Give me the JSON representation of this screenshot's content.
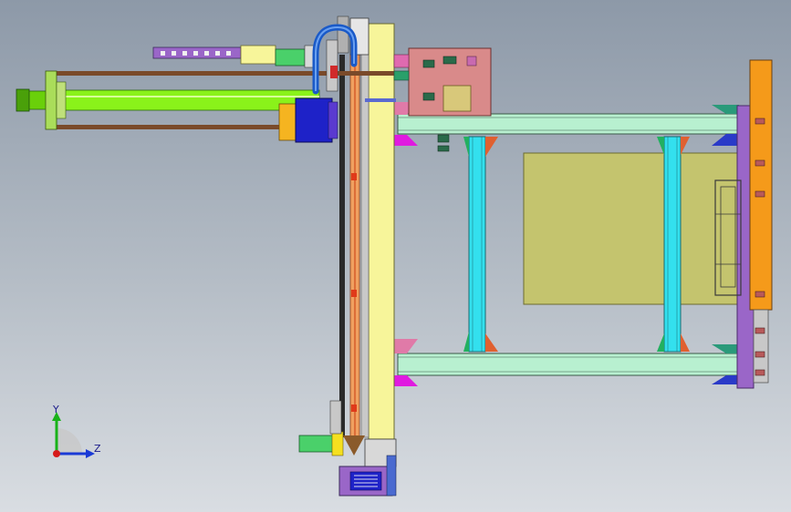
{
  "viewport": {
    "background_top": "#8d99a8",
    "background_bottom": "#d9dde2"
  },
  "triad": {
    "y_label": "Y",
    "z_label": "Z",
    "y_color": "#19b219",
    "z_color": "#1a3ad6",
    "x_color": "#d61a1a"
  },
  "colors": {
    "frame_rail": "#b8f0d0",
    "frame_post": "#33e0ee",
    "plate": "#c4c46e",
    "mast": "#f7f59a",
    "orange": "#f59a1a",
    "purple": "#9a66c8",
    "pink": "#d98a8a",
    "green_cylinder": "#8af21a",
    "navy": "#1e22c8",
    "magenta": "#e01ae0"
  }
}
